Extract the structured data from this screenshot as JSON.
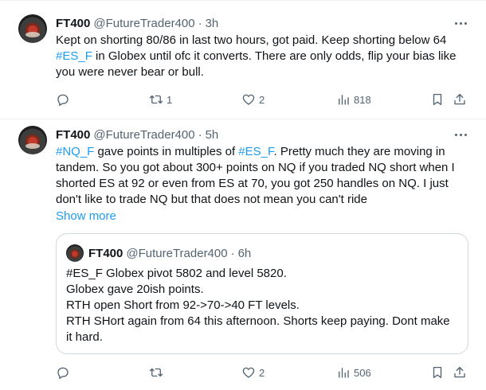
{
  "tweets": [
    {
      "author_name": "FT400",
      "author_handle": "@FutureTrader400",
      "separator": "·",
      "time": "3h",
      "text_parts": [
        "Kept on shorting 80/86 in last two hours, got paid.  Keep shorting below 64 ",
        "#ES_F",
        " in Globex until ofc it converts. There are only odds, flip your bias like you were never bear or bull."
      ],
      "stats": {
        "replies": "",
        "retweets": "1",
        "likes": "2",
        "views": "818"
      }
    },
    {
      "author_name": "FT400",
      "author_handle": "@FutureTrader400",
      "separator": "·",
      "time": "5h",
      "text_parts": [
        "#NQ_F",
        " gave points in multiples of ",
        "#ES_F",
        ".  Pretty much they are moving in tandem. So you got about 300+ points on NQ if you traded NQ short when I shorted ES at 92 or even from ES at 70, you got 250 handles on NQ. I just don't like to trade NQ but that does not mean you can't ride"
      ],
      "show_more": "Show more",
      "quote": {
        "author_name": "FT400",
        "author_handle": "@FutureTrader400",
        "separator": "·",
        "time": "6h",
        "lines": [
          "#ES_F Globex pivot 5802 and level 5820.",
          "Globex gave 20ish points.",
          "RTH open Short from 92->70->40 FT levels.",
          "RTH SHort again from 64 this afternoon. Shorts keep paying. Dont make it hard."
        ]
      },
      "stats": {
        "replies": "",
        "retweets": "",
        "likes": "2",
        "views": "506"
      }
    }
  ],
  "icons": {
    "reply": "reply-icon",
    "retweet": "retweet-icon",
    "like": "heart-icon",
    "views": "views-icon",
    "bookmark": "bookmark-icon",
    "share": "share-icon",
    "more": "more-icon"
  },
  "colors": {
    "link": "#1d9bf0",
    "muted": "#536471",
    "text": "#0f1419",
    "border": "#cfd9de"
  }
}
